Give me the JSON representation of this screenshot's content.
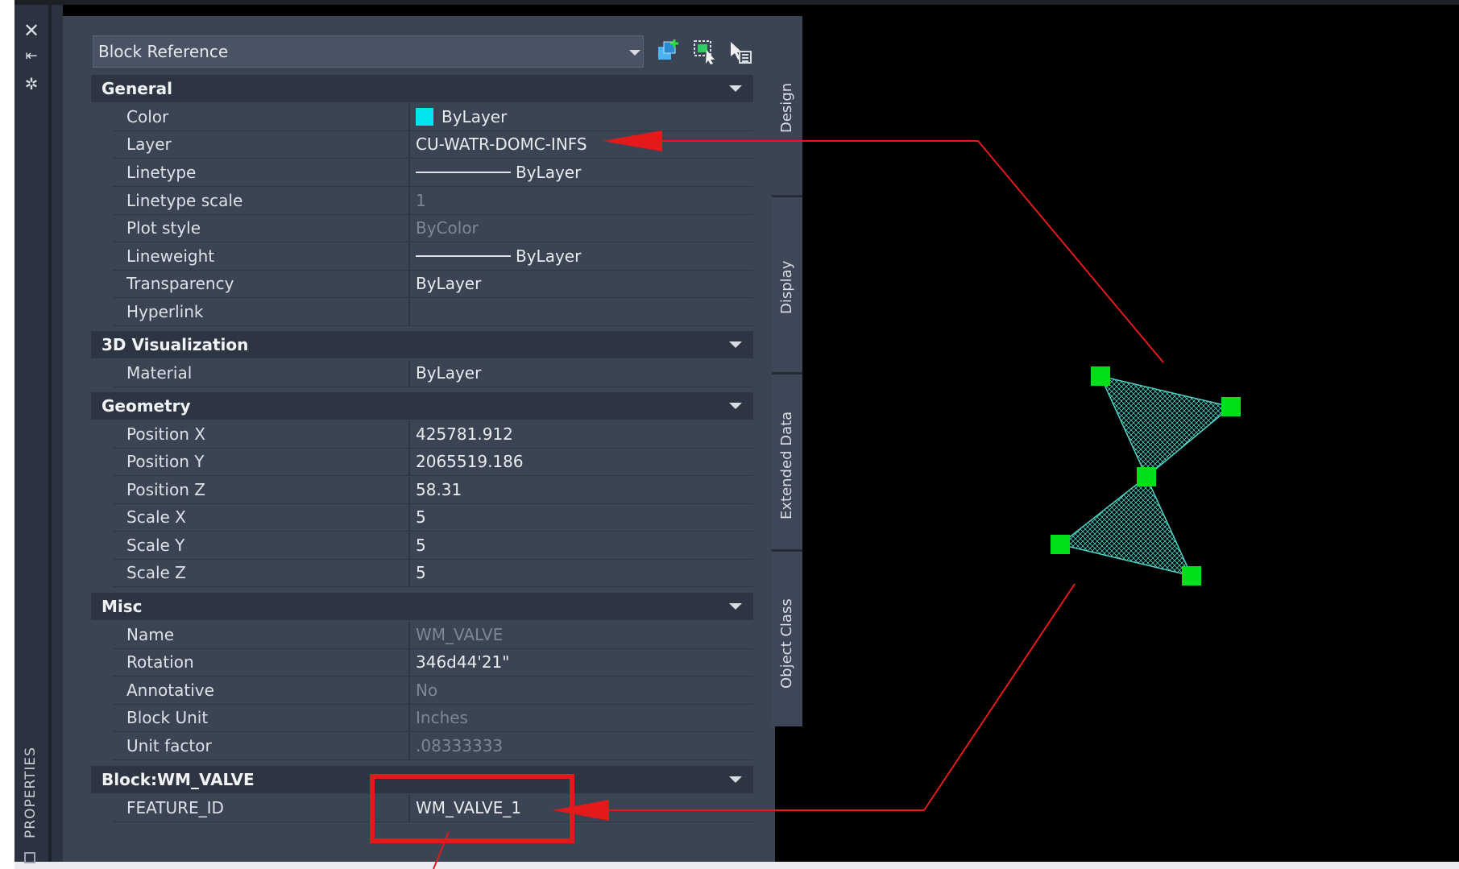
{
  "palette": {
    "label": "PROPERTIES",
    "close_icon": "close-icon",
    "autohide_icon": "pin-icon",
    "settings_icon": "settings-icon"
  },
  "selection": {
    "object_type": "Block Reference",
    "toolbar": [
      "add-to-selection-icon",
      "quick-select-icon",
      "select-objects-icon"
    ]
  },
  "sections": {
    "general": {
      "title": "General",
      "rows": [
        {
          "key": "Color",
          "value": "ByLayer"
        },
        {
          "key": "Layer",
          "value": "CU-WATR-DOMC-INFS"
        },
        {
          "key": "Linetype",
          "value": "ByLayer"
        },
        {
          "key": "Linetype scale",
          "value": "1"
        },
        {
          "key": "Plot style",
          "value": "ByColor"
        },
        {
          "key": "Lineweight",
          "value": "ByLayer"
        },
        {
          "key": "Transparency",
          "value": "ByLayer"
        },
        {
          "key": "Hyperlink",
          "value": ""
        }
      ]
    },
    "viz3d": {
      "title": "3D Visualization",
      "rows": [
        {
          "key": "Material",
          "value": "ByLayer"
        }
      ]
    },
    "geometry": {
      "title": "Geometry",
      "rows": [
        {
          "key": "Position X",
          "value": "425781.912"
        },
        {
          "key": "Position Y",
          "value": "2065519.186"
        },
        {
          "key": "Position Z",
          "value": "58.31"
        },
        {
          "key": "Scale X",
          "value": "5"
        },
        {
          "key": "Scale Y",
          "value": "5"
        },
        {
          "key": "Scale Z",
          "value": "5"
        }
      ]
    },
    "misc": {
      "title": "Misc",
      "rows": [
        {
          "key": "Name",
          "value": "WM_VALVE"
        },
        {
          "key": "Rotation",
          "value": "346d44'21\""
        },
        {
          "key": "Annotative",
          "value": "No"
        },
        {
          "key": "Block Unit",
          "value": "Inches"
        },
        {
          "key": "Unit factor",
          "value": ".08333333"
        }
      ]
    },
    "block": {
      "title": "Block:WM_VALVE",
      "rows": [
        {
          "key": "FEATURE_ID",
          "value": "WM_VALVE_1"
        }
      ]
    }
  },
  "tabs": [
    "Design",
    "Display",
    "Extended Data",
    "Object Class"
  ],
  "colors": {
    "swatch": "#00e5ee",
    "annotation": "#e3191b",
    "grip": "#00e01a",
    "hatch": "#4fd1c5"
  }
}
